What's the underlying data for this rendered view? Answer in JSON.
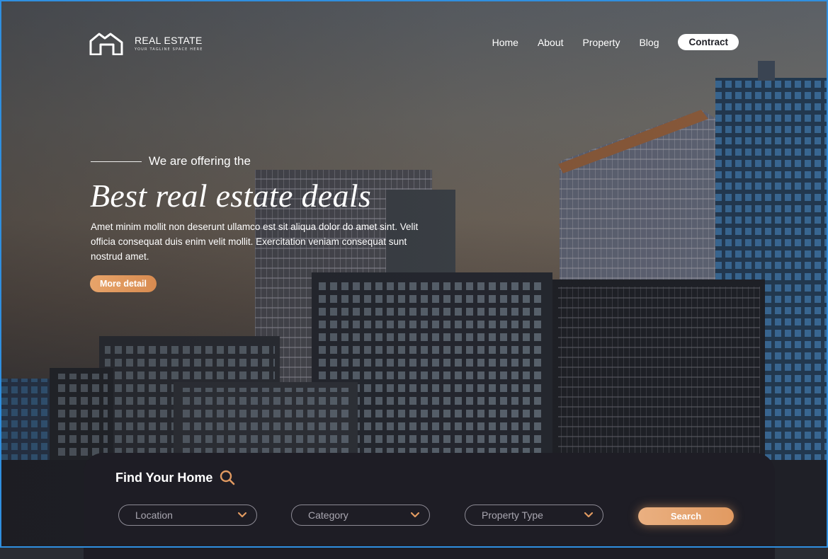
{
  "brand": {
    "name": "REAL ESTATE",
    "tagline": "YOUR TAGLINE SPACE HERE"
  },
  "nav": {
    "items": [
      "Home",
      "About",
      "Property",
      "Blog"
    ],
    "cta": "Contract"
  },
  "hero": {
    "eyebrow": "We are offering the",
    "headline": "Best real estate deals",
    "body": "Amet minim mollit non deserunt ullamco est sit aliqua dolor do amet sint. Velit officia consequat duis enim velit mollit. Exercitation veniam consequat sunt nostrud amet.",
    "button": "More detail"
  },
  "search": {
    "title": "Find Your Home",
    "fields": [
      "Location",
      "Category",
      "Property Type"
    ],
    "button": "Search"
  },
  "colors": {
    "accent": "#E19A61",
    "panel": "#1E1D25",
    "frame": "#2F8FE0",
    "text": "#FFFFFF"
  }
}
